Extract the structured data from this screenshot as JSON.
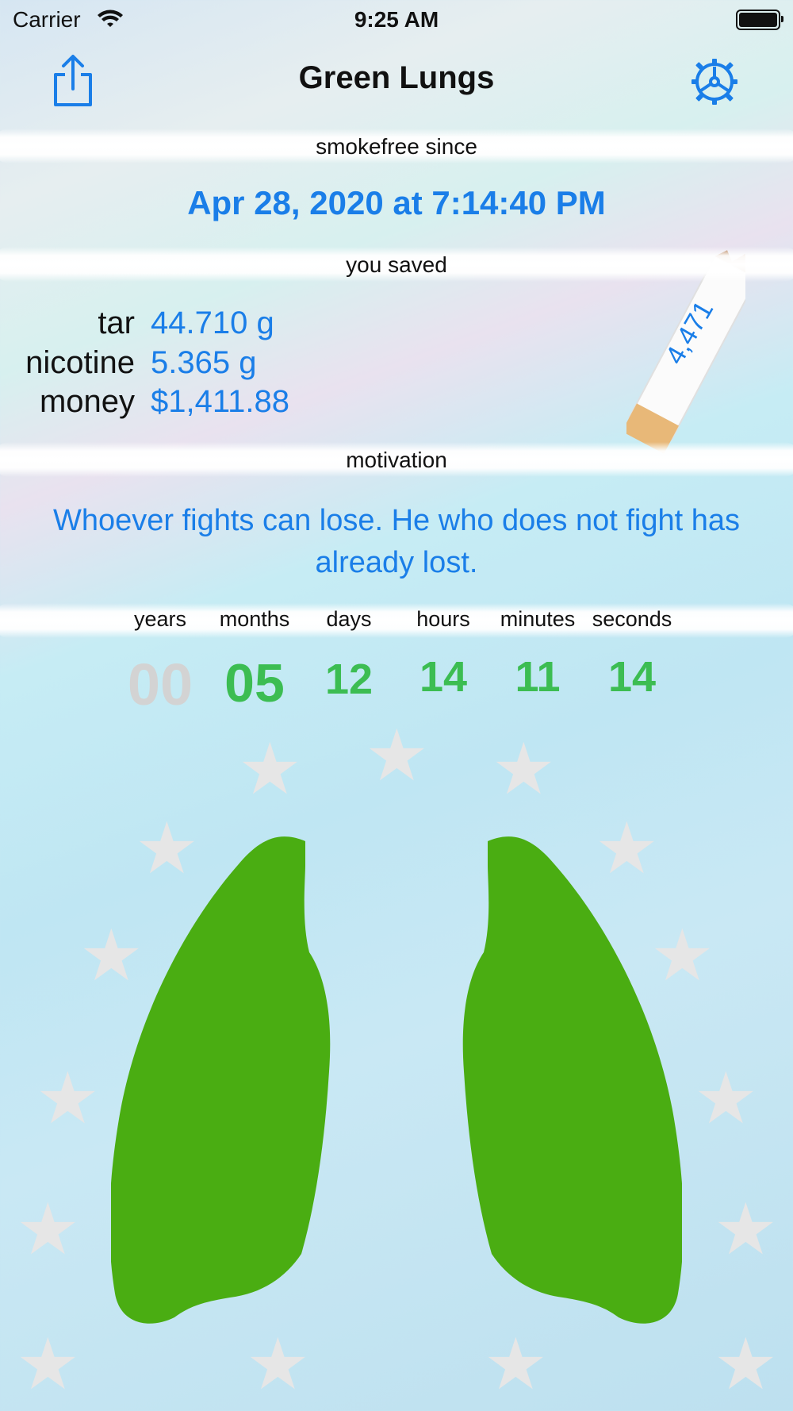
{
  "status_bar": {
    "carrier": "Carrier",
    "time": "9:25 AM"
  },
  "nav": {
    "title": "Green Lungs",
    "share_icon": "share-icon",
    "settings_icon": "gear-icon"
  },
  "sections": {
    "since_label": "smokefree since",
    "since_value": "Apr 28, 2020 at 7:14:40 PM",
    "saved_label": "you saved",
    "motivation_label": "motivation"
  },
  "saved": [
    {
      "label": "tar",
      "value": "44.710 g"
    },
    {
      "label": "nicotine",
      "value": "5.365 g"
    },
    {
      "label": "money",
      "value": "$1,411.88"
    }
  ],
  "cigarettes_count": "4,471",
  "motivation_text": "Whoever fights can lose. He who does not fight has already lost.",
  "timer": {
    "units": [
      "years",
      "months",
      "days",
      "hours",
      "minutes",
      "seconds"
    ],
    "values": [
      "00",
      "05",
      "12",
      "14",
      "11",
      "14"
    ]
  },
  "colors": {
    "accent": "#1a7ee8",
    "timer_green": "#3cbd52",
    "lungs": "#4aad12",
    "inactive": "#d3d3d3"
  }
}
